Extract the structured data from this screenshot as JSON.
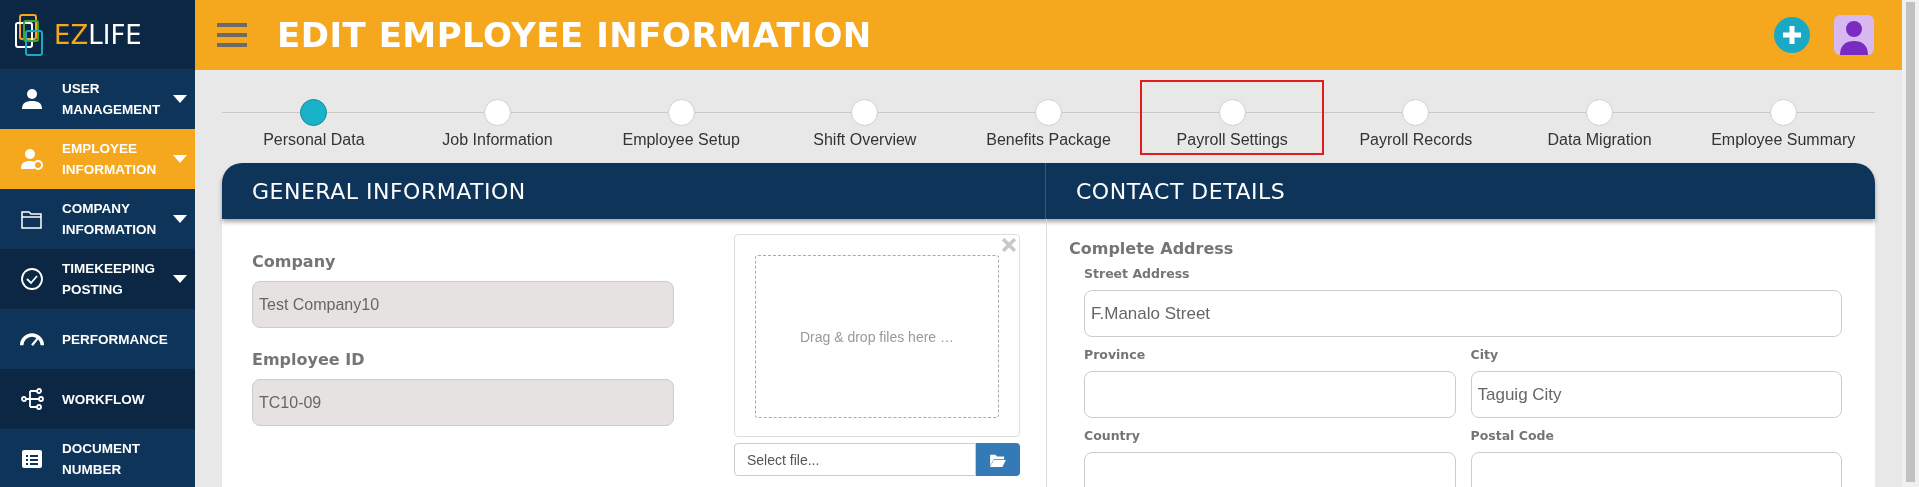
{
  "logo": [
    {
      "text": "EZ",
      "color": "#f5a81e"
    },
    {
      "text": "LIFE",
      "color": "#ffffff"
    }
  ],
  "sidebar": {
    "items": [
      {
        "label": "USER MANAGEMENT",
        "selected": false,
        "expandable": true
      },
      {
        "label": "EMPLOYEE INFORMATION",
        "selected": true,
        "expandable": true
      },
      {
        "label": "COMPANY INFORMATION",
        "selected": false,
        "expandable": true
      },
      {
        "label": "TIMEKEEPING POSTING",
        "selected": false,
        "expandable": true
      },
      {
        "label": "PERFORMANCE",
        "selected": false,
        "expandable": false
      },
      {
        "label": "WORKFLOW",
        "selected": false,
        "expandable": false
      },
      {
        "label": "DOCUMENT NUMBER",
        "selected": false,
        "expandable": false
      }
    ]
  },
  "header": {
    "title": "EDIT EMPLOYEE INFORMATION"
  },
  "stepper": {
    "steps": [
      {
        "label": "Personal Data",
        "selected": true,
        "highlighted": false
      },
      {
        "label": "Job Information",
        "selected": false,
        "highlighted": false
      },
      {
        "label": "Employee Setup",
        "selected": false,
        "highlighted": false
      },
      {
        "label": "Shift Overview",
        "selected": false,
        "highlighted": false
      },
      {
        "label": "Benefits Package",
        "selected": false,
        "highlighted": false
      },
      {
        "label": "Payroll Settings",
        "selected": false,
        "highlighted": true
      },
      {
        "label": "Payroll Records",
        "selected": false,
        "highlighted": false
      },
      {
        "label": "Data Migration",
        "selected": false,
        "highlighted": false
      },
      {
        "label": "Employee Summary",
        "selected": false,
        "highlighted": false
      }
    ]
  },
  "general_information": {
    "title": "GENERAL INFORMATION",
    "fields": [
      {
        "label": "Company",
        "value": "Test Company10",
        "disabled": true
      },
      {
        "label": "Employee ID",
        "value": "TC10-09",
        "disabled": true
      }
    ],
    "dropzone": {
      "text": "Drag & drop files here …"
    },
    "file_input": {
      "placeholder": "Select file..."
    }
  },
  "contact_details": {
    "title": "CONTACT DETAILS",
    "group_label": "Complete Address",
    "rows": [
      {
        "fields": [
          {
            "label": "Street Address",
            "value": "F.Manalo Street"
          }
        ]
      },
      {
        "fields": [
          {
            "label": "Province"
          },
          {
            "label": "City",
            "value": "Taguig City"
          }
        ]
      },
      {
        "fields": [
          {
            "label": "Country"
          },
          {
            "label": "Postal Code"
          }
        ]
      }
    ]
  }
}
